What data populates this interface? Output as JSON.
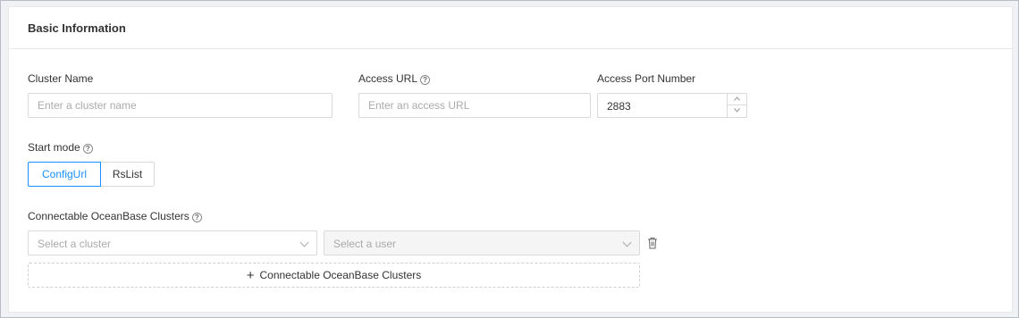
{
  "section": {
    "title": "Basic Information"
  },
  "cluster_name": {
    "label": "Cluster Name",
    "placeholder": "Enter a cluster name",
    "value": ""
  },
  "access_url": {
    "label": "Access URL",
    "placeholder": "Enter an access URL",
    "value": ""
  },
  "access_port": {
    "label": "Access Port Number",
    "value": "2883"
  },
  "start_mode": {
    "label": "Start mode",
    "options": [
      "ConfigUrl",
      "RsList"
    ],
    "selected": "ConfigUrl"
  },
  "connectable": {
    "label": "Connectable OceanBase Clusters",
    "cluster_placeholder": "Select a cluster",
    "user_placeholder": "Select a user",
    "add_button_label": "Connectable OceanBase Clusters"
  },
  "icons": {
    "help": "question-circle-icon",
    "chevron": "chevron-down-icon",
    "delete": "trash-icon",
    "add": "plus-icon"
  },
  "colors": {
    "accent": "#1890ff",
    "border": "#d9d9d9",
    "page_bg": "#f0f2f5"
  }
}
